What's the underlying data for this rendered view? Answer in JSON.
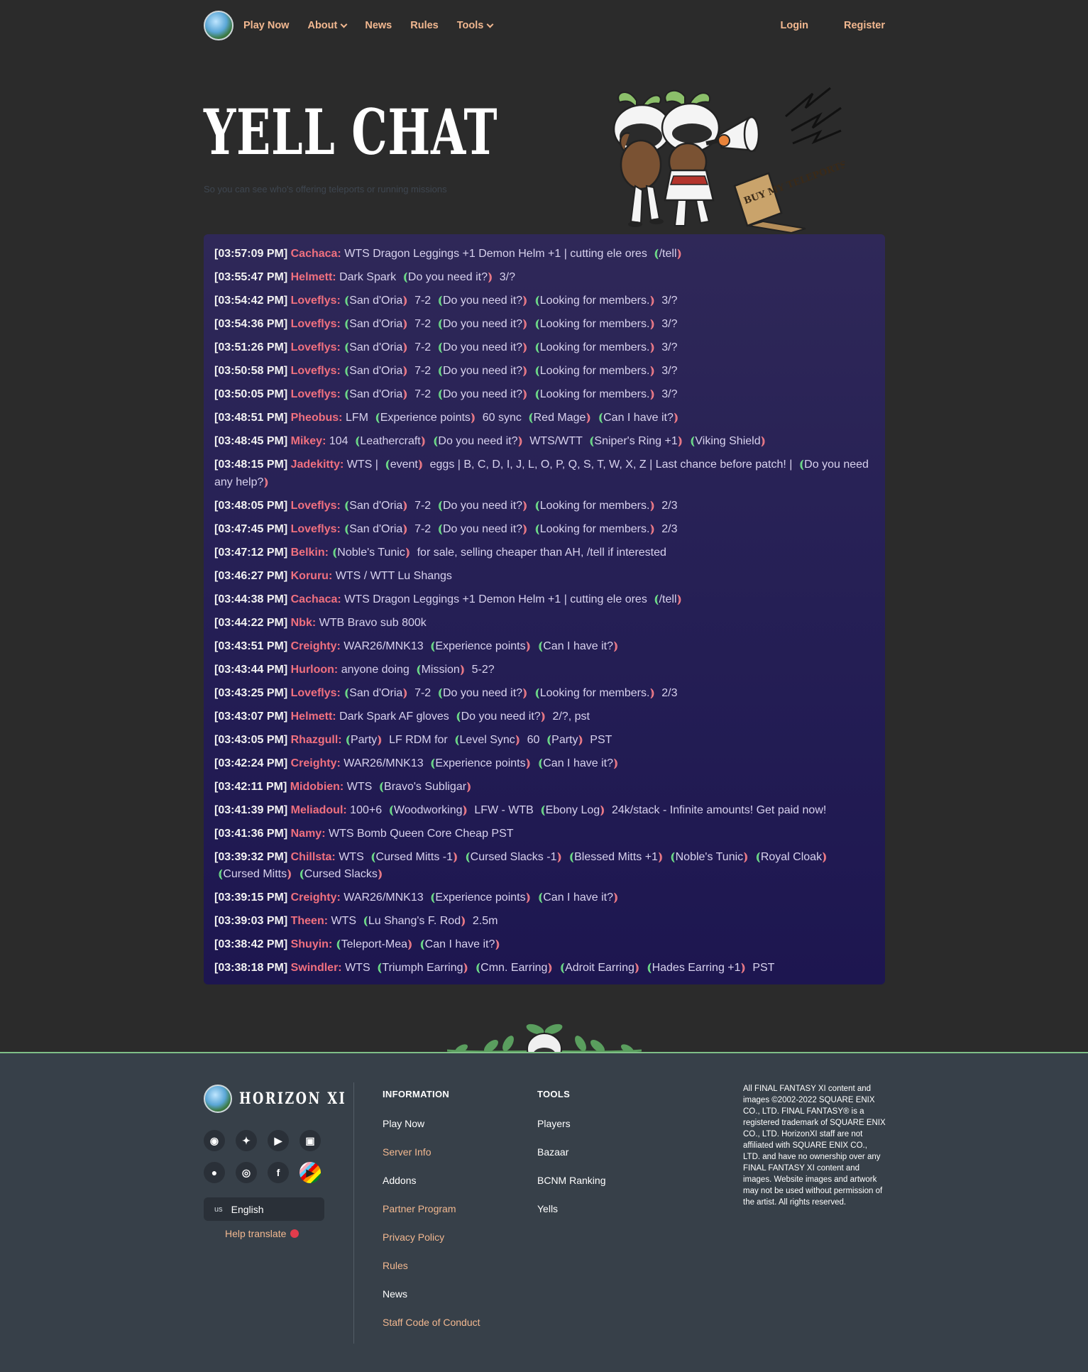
{
  "nav": {
    "links": [
      {
        "label": "Play Now",
        "dropdown": false
      },
      {
        "label": "About",
        "dropdown": true
      },
      {
        "label": "News",
        "dropdown": false
      },
      {
        "label": "Rules",
        "dropdown": false
      },
      {
        "label": "Tools",
        "dropdown": true
      }
    ],
    "login": "Login",
    "register": "Register"
  },
  "hero": {
    "title": "YELL CHAT",
    "subtitle": "So you can see who's offering teleports or running missions",
    "sign_text": "BUY MY TELEPORTS"
  },
  "colors": {
    "accent": "#f2b890",
    "name": "#f0707f",
    "open_bracket": "#6fe08a",
    "close_bracket": "#f07c88",
    "chat_bg": "#251f55",
    "footer_bg": "#374049"
  },
  "chat": {
    "messages": [
      {
        "time": "[03:57:09 PM]",
        "name": "Cachaca:",
        "parts": [
          [
            "t",
            "WTS Dragon Leggings +1 Demon Helm +1 | cutting ele ores"
          ],
          [
            "a",
            "/tell"
          ]
        ]
      },
      {
        "time": "[03:55:47 PM]",
        "name": "Helmett:",
        "parts": [
          [
            "t",
            "Dark Spark"
          ],
          [
            "a",
            "Do you need it?"
          ],
          [
            "t",
            "3/?"
          ]
        ]
      },
      {
        "time": "[03:54:42 PM]",
        "name": "Loveflys:",
        "parts": [
          [
            "a",
            "San d'Oria"
          ],
          [
            "t",
            "7-2"
          ],
          [
            "a",
            "Do you need it?"
          ],
          [
            "a",
            "Looking for members."
          ],
          [
            "t",
            "3/?"
          ]
        ]
      },
      {
        "time": "[03:54:36 PM]",
        "name": "Loveflys:",
        "parts": [
          [
            "a",
            "San d'Oria"
          ],
          [
            "t",
            "7-2"
          ],
          [
            "a",
            "Do you need it?"
          ],
          [
            "a",
            "Looking for members."
          ],
          [
            "t",
            "3/?"
          ]
        ]
      },
      {
        "time": "[03:51:26 PM]",
        "name": "Loveflys:",
        "parts": [
          [
            "a",
            "San d'Oria"
          ],
          [
            "t",
            "7-2"
          ],
          [
            "a",
            "Do you need it?"
          ],
          [
            "a",
            "Looking for members."
          ],
          [
            "t",
            "3/?"
          ]
        ]
      },
      {
        "time": "[03:50:58 PM]",
        "name": "Loveflys:",
        "parts": [
          [
            "a",
            "San d'Oria"
          ],
          [
            "t",
            "7-2"
          ],
          [
            "a",
            "Do you need it?"
          ],
          [
            "a",
            "Looking for members."
          ],
          [
            "t",
            "3/?"
          ]
        ]
      },
      {
        "time": "[03:50:05 PM]",
        "name": "Loveflys:",
        "parts": [
          [
            "a",
            "San d'Oria"
          ],
          [
            "t",
            "7-2"
          ],
          [
            "a",
            "Do you need it?"
          ],
          [
            "a",
            "Looking for members."
          ],
          [
            "t",
            "3/?"
          ]
        ]
      },
      {
        "time": "[03:48:51 PM]",
        "name": "Pheobus:",
        "parts": [
          [
            "t",
            "LFM"
          ],
          [
            "a",
            "Experience points"
          ],
          [
            "t",
            "60 sync"
          ],
          [
            "a",
            "Red Mage"
          ],
          [
            "a",
            "Can I have it?"
          ]
        ]
      },
      {
        "time": "[03:48:45 PM]",
        "name": "Mikey:",
        "parts": [
          [
            "t",
            "104"
          ],
          [
            "a",
            "Leathercraft"
          ],
          [
            "a",
            "Do you need it?"
          ],
          [
            "t",
            "WTS/WTT"
          ],
          [
            "a",
            "Sniper's Ring +1"
          ],
          [
            "a",
            "Viking Shield"
          ]
        ]
      },
      {
        "time": "[03:48:15 PM]",
        "name": "Jadekitty:",
        "parts": [
          [
            "t",
            "WTS |"
          ],
          [
            "a",
            "event"
          ],
          [
            "t",
            "eggs | B, C, D, I, J, L, O, P, Q, S, T, W, X, Z | Last chance before patch! |"
          ],
          [
            "a",
            "Do you need any help?"
          ]
        ]
      },
      {
        "time": "[03:48:05 PM]",
        "name": "Loveflys:",
        "parts": [
          [
            "a",
            "San d'Oria"
          ],
          [
            "t",
            "7-2"
          ],
          [
            "a",
            "Do you need it?"
          ],
          [
            "a",
            "Looking for members."
          ],
          [
            "t",
            "2/3"
          ]
        ]
      },
      {
        "time": "[03:47:45 PM]",
        "name": "Loveflys:",
        "parts": [
          [
            "a",
            "San d'Oria"
          ],
          [
            "t",
            "7-2"
          ],
          [
            "a",
            "Do you need it?"
          ],
          [
            "a",
            "Looking for members."
          ],
          [
            "t",
            "2/3"
          ]
        ]
      },
      {
        "time": "[03:47:12 PM]",
        "name": "Belkin:",
        "parts": [
          [
            "a",
            "Noble's Tunic"
          ],
          [
            "t",
            "for sale, selling cheaper than AH, /tell if interested"
          ]
        ]
      },
      {
        "time": "[03:46:27 PM]",
        "name": "Koruru:",
        "parts": [
          [
            "t",
            "WTS / WTT Lu Shangs"
          ]
        ]
      },
      {
        "time": "[03:44:38 PM]",
        "name": "Cachaca:",
        "parts": [
          [
            "t",
            "WTS Dragon Leggings +1 Demon Helm +1 | cutting ele ores"
          ],
          [
            "a",
            "/tell"
          ]
        ]
      },
      {
        "time": "[03:44:22 PM]",
        "name": "Nbk:",
        "parts": [
          [
            "t",
            "WTB Bravo sub 800k"
          ]
        ]
      },
      {
        "time": "[03:43:51 PM]",
        "name": "Creighty:",
        "parts": [
          [
            "t",
            "WAR26/MNK13"
          ],
          [
            "a",
            "Experience points"
          ],
          [
            "a",
            "Can I have it?"
          ]
        ]
      },
      {
        "time": "[03:43:44 PM]",
        "name": "Hurloon:",
        "parts": [
          [
            "t",
            "anyone doing"
          ],
          [
            "a",
            "Mission"
          ],
          [
            "t",
            "5-2?"
          ]
        ]
      },
      {
        "time": "[03:43:25 PM]",
        "name": "Loveflys:",
        "parts": [
          [
            "a",
            "San d'Oria"
          ],
          [
            "t",
            "7-2"
          ],
          [
            "a",
            "Do you need it?"
          ],
          [
            "a",
            "Looking for members."
          ],
          [
            "t",
            "2/3"
          ]
        ]
      },
      {
        "time": "[03:43:07 PM]",
        "name": "Helmett:",
        "parts": [
          [
            "t",
            "Dark Spark AF gloves"
          ],
          [
            "a",
            "Do you need it?"
          ],
          [
            "t",
            "2/?, pst"
          ]
        ]
      },
      {
        "time": "[03:43:05 PM]",
        "name": "Rhazgull:",
        "parts": [
          [
            "a",
            "Party"
          ],
          [
            "t",
            "LF RDM for"
          ],
          [
            "a",
            "Level Sync"
          ],
          [
            "t",
            "60"
          ],
          [
            "a",
            "Party"
          ],
          [
            "t",
            "PST"
          ]
        ]
      },
      {
        "time": "[03:42:24 PM]",
        "name": "Creighty:",
        "parts": [
          [
            "t",
            "WAR26/MNK13"
          ],
          [
            "a",
            "Experience points"
          ],
          [
            "a",
            "Can I have it?"
          ]
        ]
      },
      {
        "time": "[03:42:11 PM]",
        "name": "Midobien:",
        "parts": [
          [
            "t",
            "WTS"
          ],
          [
            "a",
            "Bravo's Subligar"
          ]
        ]
      },
      {
        "time": "[03:41:39 PM]",
        "name": "Meliadoul:",
        "parts": [
          [
            "t",
            "100+6"
          ],
          [
            "a",
            "Woodworking"
          ],
          [
            "t",
            "LFW - WTB"
          ],
          [
            "a",
            "Ebony Log"
          ],
          [
            "t",
            "24k/stack - Infinite amounts! Get paid now!"
          ]
        ]
      },
      {
        "time": "[03:41:36 PM]",
        "name": "Namy:",
        "parts": [
          [
            "t",
            "WTS Bomb Queen Core Cheap PST"
          ]
        ]
      },
      {
        "time": "[03:39:32 PM]",
        "name": "Chillsta:",
        "parts": [
          [
            "t",
            "WTS"
          ],
          [
            "a",
            "Cursed Mitts -1"
          ],
          [
            "a",
            "Cursed Slacks -1"
          ],
          [
            "a",
            "Blessed Mitts +1"
          ],
          [
            "a",
            "Noble's Tunic"
          ],
          [
            "a",
            "Royal Cloak"
          ],
          [
            "a",
            "Cursed Mitts"
          ],
          [
            "a",
            "Cursed Slacks"
          ]
        ]
      },
      {
        "time": "[03:39:15 PM]",
        "name": "Creighty:",
        "parts": [
          [
            "t",
            "WAR26/MNK13"
          ],
          [
            "a",
            "Experience points"
          ],
          [
            "a",
            "Can I have it?"
          ]
        ]
      },
      {
        "time": "[03:39:03 PM]",
        "name": "Theen:",
        "parts": [
          [
            "t",
            "WTS"
          ],
          [
            "a",
            "Lu Shang's F. Rod"
          ],
          [
            "t",
            "2.5m"
          ]
        ]
      },
      {
        "time": "[03:38:42 PM]",
        "name": "Shuyin:",
        "parts": [
          [
            "a",
            "Teleport-Mea"
          ],
          [
            "a",
            "Can I have it?"
          ]
        ]
      },
      {
        "time": "[03:38:18 PM]",
        "name": "Swindler:",
        "parts": [
          [
            "t",
            "WTS"
          ],
          [
            "a",
            "Triumph Earring"
          ],
          [
            "a",
            "Cmn. Earring"
          ],
          [
            "a",
            "Adroit Earring"
          ],
          [
            "a",
            "Hades Earring +1"
          ],
          [
            "t",
            "PST"
          ]
        ]
      }
    ]
  },
  "footer": {
    "brand": "HORIZON XI",
    "socials": [
      {
        "icon": "discord-icon",
        "glyph": "◉"
      },
      {
        "icon": "twitter-icon",
        "glyph": "✦"
      },
      {
        "icon": "youtube-icon",
        "glyph": "▶"
      },
      {
        "icon": "twitch-icon",
        "glyph": "▣"
      },
      {
        "icon": "reddit-icon",
        "glyph": "●"
      },
      {
        "icon": "instagram-icon",
        "glyph": "◎"
      },
      {
        "icon": "facebook-icon",
        "glyph": "f"
      },
      {
        "icon": "pride-flag-icon",
        "glyph": "▶"
      }
    ],
    "language": {
      "code": "us",
      "label": "English"
    },
    "help_translate": "Help translate",
    "info_heading": "INFORMATION",
    "info_links": [
      {
        "label": "Play Now",
        "style": "white"
      },
      {
        "label": "Server Info",
        "style": "accent"
      },
      {
        "label": "Addons",
        "style": "white"
      },
      {
        "label": "Partner Program",
        "style": "accent"
      },
      {
        "label": "Privacy Policy",
        "style": "accent"
      },
      {
        "label": "Rules",
        "style": "accent"
      },
      {
        "label": "News",
        "style": "white"
      },
      {
        "label": "Staff Code of Conduct",
        "style": "accent"
      }
    ],
    "tools_heading": "TOOLS",
    "tools_links": [
      {
        "label": "Players",
        "style": "white"
      },
      {
        "label": "Bazaar",
        "style": "white"
      },
      {
        "label": "BCNM Ranking",
        "style": "white"
      },
      {
        "label": "Yells",
        "style": "white"
      }
    ],
    "legal": "All FINAL FANTASY XI content and images ©2002-2022 SQUARE ENIX CO., LTD. FINAL FANTASY® is a registered trademark of SQUARE ENIX CO., LTD. HorizonXI staff are not affiliated with SQUARE ENIX CO., LTD. and have no ownership over any FINAL FANTASY XI content and images. Website images and artwork may not be used without permission of the artist. All rights reserved."
  }
}
